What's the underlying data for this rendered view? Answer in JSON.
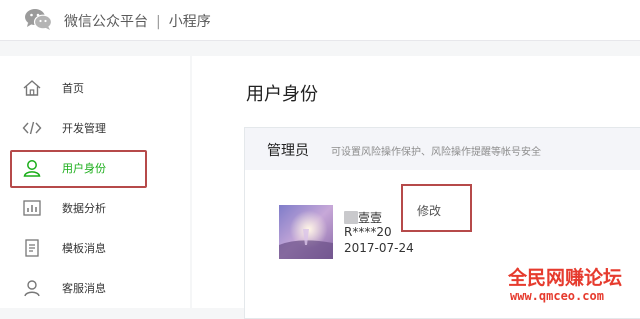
{
  "header": {
    "platform": "微信公众平台",
    "separator": "|",
    "product": "小程序"
  },
  "sidebar": {
    "items": [
      {
        "label": "首页",
        "icon": "home-icon"
      },
      {
        "label": "开发管理",
        "icon": "code-icon"
      },
      {
        "label": "用户身份",
        "icon": "user-icon",
        "active": true
      },
      {
        "label": "数据分析",
        "icon": "bar-chart-icon"
      },
      {
        "label": "模板消息",
        "icon": "document-icon"
      },
      {
        "label": "客服消息",
        "icon": "customer-service-icon"
      }
    ]
  },
  "main": {
    "title": "用户身份",
    "card": {
      "title": "管理员",
      "description": "可设置风险操作保护、风险操作提醒等帐号安全",
      "admin": {
        "name": "壹壹",
        "wechat_id": "R****20",
        "date": "2017-07-24"
      },
      "modify_label": "修改"
    }
  },
  "watermark": {
    "title": "全民网赚论坛",
    "url": "www.qmceo.com"
  },
  "colors": {
    "accent_green": "#1aad19",
    "highlight_red": "#b64a4a",
    "watermark_red": "#e63b2e"
  }
}
